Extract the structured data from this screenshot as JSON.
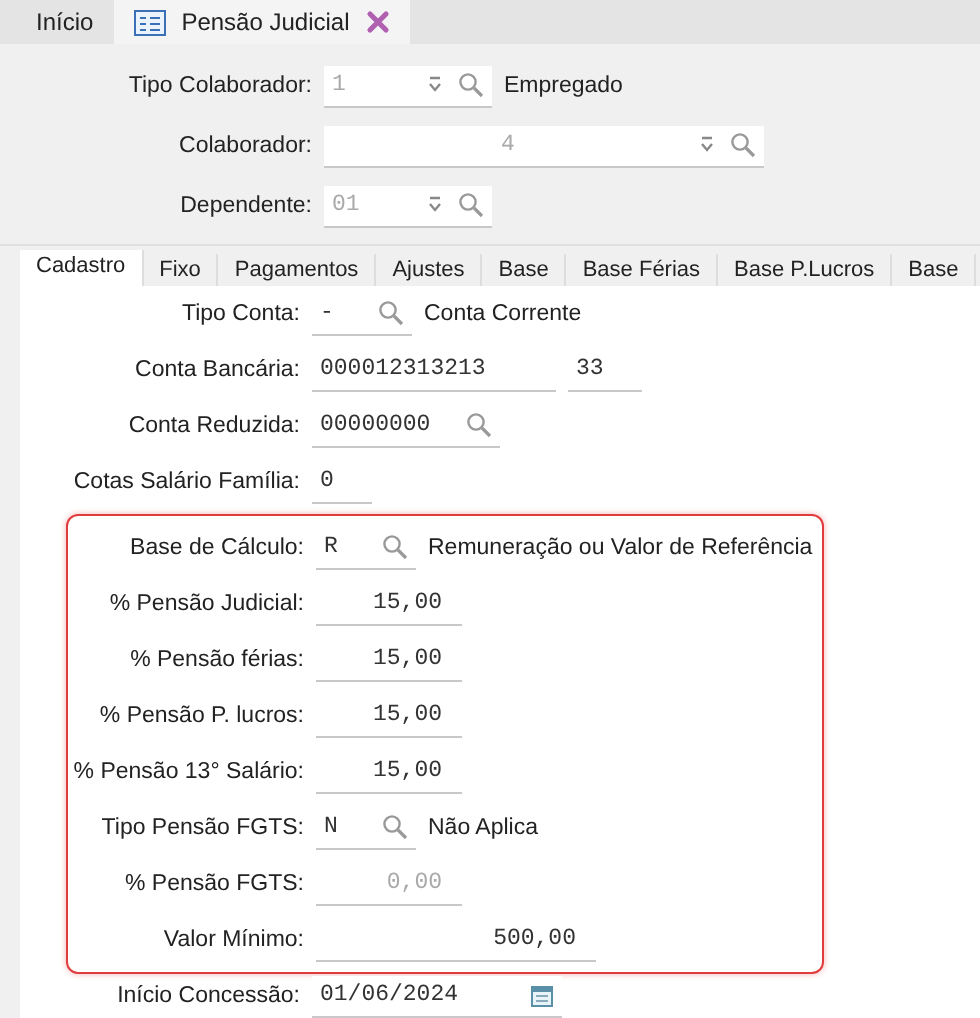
{
  "doc_tabs": [
    {
      "label": "Início",
      "selected": false,
      "icon": false,
      "closable": false
    },
    {
      "label": "Pensão Judicial",
      "selected": true,
      "icon": true,
      "closable": true
    }
  ],
  "header": [
    {
      "label": "Tipo Colaborador:",
      "fields": [
        {
          "kind": "combo",
          "value": "1",
          "disabled": true
        }
      ],
      "description": "Empregado"
    },
    {
      "label": "Colaborador:",
      "fields": [
        {
          "kind": "wide_combo",
          "value": "4",
          "disabled": true
        }
      ]
    },
    {
      "label": "Dependente:",
      "fields": [
        {
          "kind": "combo",
          "value": "01",
          "disabled": true
        }
      ]
    }
  ],
  "tabs": [
    {
      "label": "Cadastro",
      "selected": true
    },
    {
      "label": "Fixo",
      "selected": false
    },
    {
      "label": "Pagamentos",
      "selected": false
    },
    {
      "label": "Ajustes",
      "selected": false
    },
    {
      "label": "Base",
      "selected": false
    },
    {
      "label": "Base Férias",
      "selected": false
    },
    {
      "label": "Base P.Lucros",
      "selected": false
    },
    {
      "label": "Base",
      "selected": false
    }
  ],
  "rows": [
    {
      "label": "Tipo Conta:",
      "fields": [
        {
          "kind": "lookup",
          "value": "-",
          "disabled": false
        }
      ],
      "description": "Conta Corrente"
    },
    {
      "label": "Conta Bancária:",
      "fields": [
        {
          "kind": "text",
          "value": "000012313213",
          "disabled": false
        },
        {
          "kind": "text",
          "value": "33",
          "disabled": false
        }
      ]
    },
    {
      "label": "Conta Reduzida:",
      "fields": [
        {
          "kind": "lookup",
          "value": "00000000",
          "disabled": false
        }
      ]
    },
    {
      "label": "Cotas Salário Família:",
      "fields": [
        {
          "kind": "text",
          "value": "0",
          "disabled": false
        }
      ]
    }
  ],
  "highlighted_rows": [
    {
      "label": "Base de Cálculo:",
      "fields": [
        {
          "kind": "lookup",
          "value": "R",
          "disabled": false
        }
      ],
      "description": "Remuneração ou Valor de Referência"
    },
    {
      "label": "% Pensão Judicial:",
      "fields": [
        {
          "kind": "percent",
          "value": "15,00",
          "disabled": false
        }
      ]
    },
    {
      "label": "% Pensão férias:",
      "fields": [
        {
          "kind": "percent",
          "value": "15,00",
          "disabled": false
        }
      ]
    },
    {
      "label": "% Pensão P. lucros:",
      "fields": [
        {
          "kind": "percent",
          "value": "15,00",
          "disabled": false
        }
      ]
    },
    {
      "label": "% Pensão 13° Salário:",
      "fields": [
        {
          "kind": "percent",
          "value": "15,00",
          "disabled": false
        }
      ]
    },
    {
      "label": "Tipo Pensão FGTS:",
      "fields": [
        {
          "kind": "lookup",
          "value": "N",
          "disabled": false
        }
      ],
      "description": "Não Aplica"
    },
    {
      "label": "% Pensão FGTS:",
      "fields": [
        {
          "kind": "percent",
          "value": "0,00",
          "disabled": true
        }
      ]
    },
    {
      "label": "Valor Mínimo:",
      "fields": [
        {
          "kind": "amount",
          "value": "500,00",
          "disabled": false
        }
      ]
    }
  ],
  "after_rows": [
    {
      "label": "Início Concessão:",
      "fields": [
        {
          "kind": "date",
          "value": "01/06/2024",
          "disabled": false
        }
      ]
    }
  ]
}
